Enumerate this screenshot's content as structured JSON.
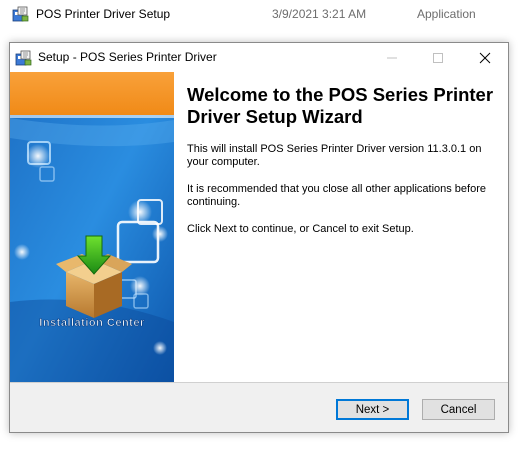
{
  "file_row": {
    "icon": "installer-icon",
    "name": "POS Printer Driver Setup",
    "date": "3/9/2021 3:21 AM",
    "type": "Application"
  },
  "window": {
    "title": "Setup - POS Series Printer Driver",
    "icon": "installer-icon",
    "controls": [
      "minimize-icon",
      "maximize-icon",
      "close-icon"
    ]
  },
  "banner": {
    "label": "Installation Center",
    "colors": {
      "top": "#f7931e",
      "blue": "#1e7fd0",
      "dark_blue": "#0d4f9e"
    }
  },
  "wizard": {
    "heading": "Welcome to the POS Series Printer Driver Setup Wizard",
    "paragraph1": "This will install POS Series Printer Driver version 11.3.0.1 on your computer.",
    "paragraph2": "It is recommended that you close all other applications before continuing.",
    "paragraph3": "Click Next to continue, or Cancel to exit Setup."
  },
  "buttons": {
    "next": "Next >",
    "cancel": "Cancel"
  }
}
